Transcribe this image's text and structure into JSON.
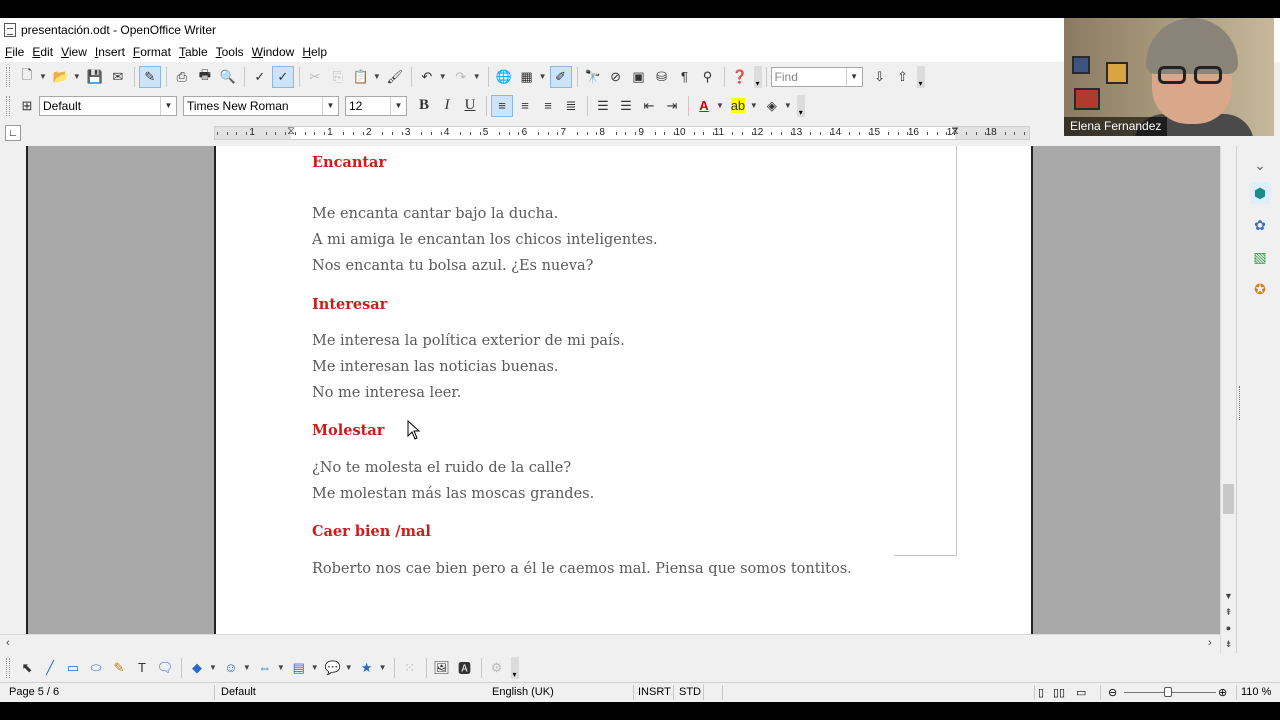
{
  "window": {
    "title": "presentación.odt - OpenOffice Writer"
  },
  "menu": [
    "File",
    "Edit",
    "View",
    "Insert",
    "Format",
    "Table",
    "Tools",
    "Window",
    "Help"
  ],
  "find": {
    "placeholder": "Find"
  },
  "formatting": {
    "style": "Default",
    "font": "Times New Roman",
    "size": "12"
  },
  "ruler": {
    "labels": [
      "1",
      "1",
      "2",
      "3",
      "4",
      "5",
      "6",
      "7",
      "8",
      "9",
      "10",
      "11",
      "12",
      "13",
      "14",
      "15",
      "16",
      "17",
      "18"
    ]
  },
  "document": {
    "lines": [
      {
        "text": "Encantar",
        "heading": true
      },
      {
        "text": "Me encanta cantar bajo la ducha.",
        "heading": false
      },
      {
        "text": "A mi amiga le encantan los chicos inteligentes.",
        "heading": false
      },
      {
        "text": "Nos encanta tu bolsa azul. ¿Es nueva?",
        "heading": false
      },
      {
        "text": "Interesar",
        "heading": true
      },
      {
        "text": "Me interesa la política exterior de mi país.",
        "heading": false
      },
      {
        "text": "Me interesan las noticias buenas.",
        "heading": false
      },
      {
        "text": "No me interesa leer.",
        "heading": false
      },
      {
        "text": "Molestar",
        "heading": true
      },
      {
        "text": "¿No te molesta el ruido de la calle?",
        "heading": false
      },
      {
        "text": "Me molestan más las moscas grandes.",
        "heading": false
      },
      {
        "text": "Caer bien /mal",
        "heading": true
      },
      {
        "text": "Roberto nos cae bien pero a él le caemos mal. Piensa que somos tontitos.",
        "heading": false
      }
    ]
  },
  "status": {
    "page": "Page 5 / 6",
    "page_style": "Default",
    "language": "English (UK)",
    "insert_mode": "INSRT",
    "selection_mode": "STD",
    "zoom": "110 %"
  },
  "webcam": {
    "name": "Elena Fernandez"
  },
  "colors": {
    "heading": "#d11b1b",
    "body_text": "#5a5a5a",
    "page_bg": "#ffffff",
    "workspace_bg": "#a9a9a9"
  }
}
